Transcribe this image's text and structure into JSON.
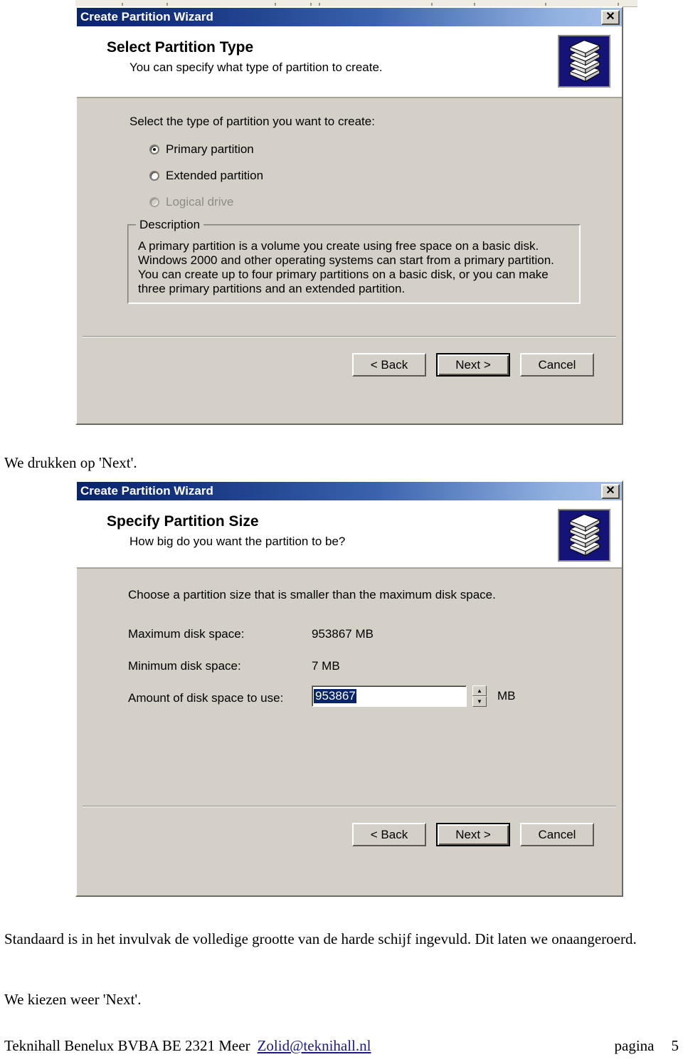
{
  "document": {
    "paragraph_1": "We drukken op 'Next'.",
    "paragraph_2": "Standaard is in het invulvak de volledige grootte van de harde schijf ingevuld. Dit laten we onaangeroerd.",
    "paragraph_3": "We kiezen weer 'Next'.",
    "footer": {
      "company": "Teknihall Benelux BVBA   BE 2321 Meer",
      "email": "Zolid@teknihall.nl",
      "page_label": "pagina",
      "page_number": "5",
      "link_color": "#1a1a8c"
    }
  },
  "dialog_1": {
    "title": "Create Partition Wizard",
    "close_icon": "close-icon",
    "header": {
      "heading": "Select Partition Type",
      "subheading": "You can specify what type of partition to create.",
      "icon": "disk-stack-icon"
    },
    "prompt": "Select the type of partition you want to create:",
    "options": [
      {
        "label": "Primary partition",
        "selected": true,
        "disabled": false
      },
      {
        "label": "Extended partition",
        "selected": false,
        "disabled": false
      },
      {
        "label": "Logical drive",
        "selected": false,
        "disabled": true
      }
    ],
    "description": {
      "legend": "Description",
      "lines": [
        "A primary partition is a volume you create using free space on a basic disk.",
        "Windows 2000 and other operating systems can start from a primary partition.",
        "You can create up to four primary partitions on a basic disk, or you can make",
        "three primary partitions and an extended partition."
      ]
    },
    "buttons": {
      "back": "< Back",
      "next": "Next >",
      "cancel": "Cancel"
    }
  },
  "dialog_2": {
    "title": "Create Partition Wizard",
    "close_icon": "close-icon",
    "header": {
      "heading": "Specify Partition Size",
      "subheading": "How big do you want the partition to be?",
      "icon": "disk-stack-icon"
    },
    "prompt": "Choose a partition size that is smaller than the maximum disk space.",
    "fields": [
      {
        "label": "Maximum disk space:",
        "value": "953867 MB"
      },
      {
        "label": "Minimum disk space:",
        "value": "7 MB"
      }
    ],
    "amount": {
      "label": "Amount of disk space to use:",
      "value": "953867",
      "unit": "MB",
      "spin_up_icon": "chevron-up-icon",
      "spin_down_icon": "chevron-down-icon"
    },
    "buttons": {
      "back": "< Back",
      "next": "Next >",
      "cancel": "Cancel"
    }
  },
  "theme": {
    "dialog_face": "#d4d0c8",
    "titlebar_start": "#0a246a",
    "titlebar_end": "#a6c0e8",
    "selection_blue": "#0a246a",
    "icon_bg": "#141478"
  }
}
